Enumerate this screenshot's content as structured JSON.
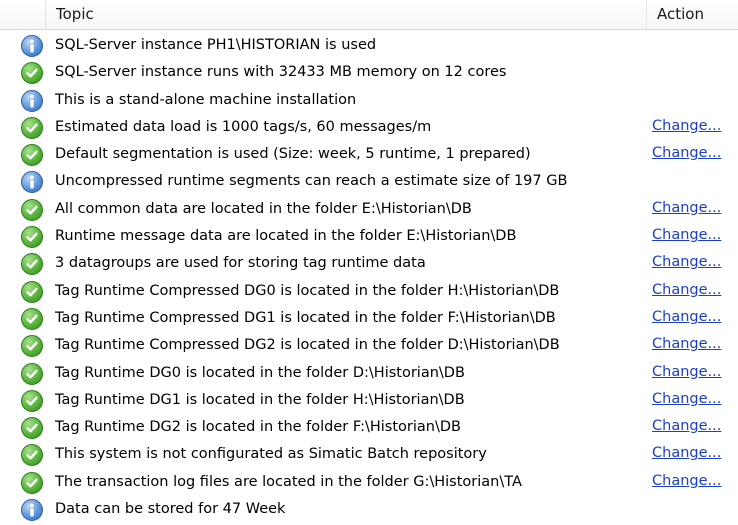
{
  "header": {
    "topic_label": "Topic",
    "action_label": "Action"
  },
  "rows": [
    {
      "status": "info",
      "icon": "info-icon",
      "topic": "SQL-Server instance PH1\\HISTORIAN is used",
      "action": ""
    },
    {
      "status": "ok",
      "icon": "check-icon",
      "topic": "SQL-Server instance runs with 32433 MB memory on 12 cores",
      "action": ""
    },
    {
      "status": "info",
      "icon": "info-icon",
      "topic": "This is a stand-alone machine installation",
      "action": ""
    },
    {
      "status": "ok",
      "icon": "check-icon",
      "topic": "Estimated data load is 1000 tags/s, 60 messages/m",
      "action": "Change..."
    },
    {
      "status": "ok",
      "icon": "check-icon",
      "topic": "Default segmentation is used (Size: week, 5 runtime, 1 prepared)",
      "action": "Change..."
    },
    {
      "status": "info",
      "icon": "info-icon",
      "topic": "Uncompressed runtime segments can reach a estimate size of 197 GB",
      "action": ""
    },
    {
      "status": "ok",
      "icon": "check-icon",
      "topic": "All common data are located in the folder E:\\Historian\\DB",
      "action": "Change..."
    },
    {
      "status": "ok",
      "icon": "check-icon",
      "topic": "Runtime message data are located in the folder E:\\Historian\\DB",
      "action": "Change..."
    },
    {
      "status": "ok",
      "icon": "check-icon",
      "topic": "3 datagroups are used for storing tag runtime data",
      "action": "Change..."
    },
    {
      "status": "ok",
      "icon": "check-icon",
      "topic": "Tag Runtime Compressed DG0 is located in the folder H:\\Historian\\DB",
      "action": "Change..."
    },
    {
      "status": "ok",
      "icon": "check-icon",
      "topic": "Tag Runtime Compressed DG1 is located in the folder F:\\Historian\\DB",
      "action": "Change..."
    },
    {
      "status": "ok",
      "icon": "check-icon",
      "topic": "Tag Runtime Compressed DG2 is located in the folder D:\\Historian\\DB",
      "action": "Change..."
    },
    {
      "status": "ok",
      "icon": "check-icon",
      "topic": "Tag Runtime DG0 is located in the folder D:\\Historian\\DB",
      "action": "Change..."
    },
    {
      "status": "ok",
      "icon": "check-icon",
      "topic": "Tag Runtime DG1 is located in the folder H:\\Historian\\DB",
      "action": "Change..."
    },
    {
      "status": "ok",
      "icon": "check-icon",
      "topic": "Tag Runtime DG2 is located in the folder F:\\Historian\\DB",
      "action": "Change..."
    },
    {
      "status": "ok",
      "icon": "check-icon",
      "topic": "This system is not configurated as Simatic Batch repository",
      "action": "Change..."
    },
    {
      "status": "ok",
      "icon": "check-icon",
      "topic": "The transaction log files are located in the folder G:\\Historian\\TA",
      "action": "Change..."
    },
    {
      "status": "info",
      "icon": "info-icon",
      "topic": "Data can be stored for 47 Week",
      "action": ""
    }
  ],
  "colors": {
    "link": "#1b3fc7",
    "ok": "#57b33a",
    "info": "#5d95d8"
  }
}
